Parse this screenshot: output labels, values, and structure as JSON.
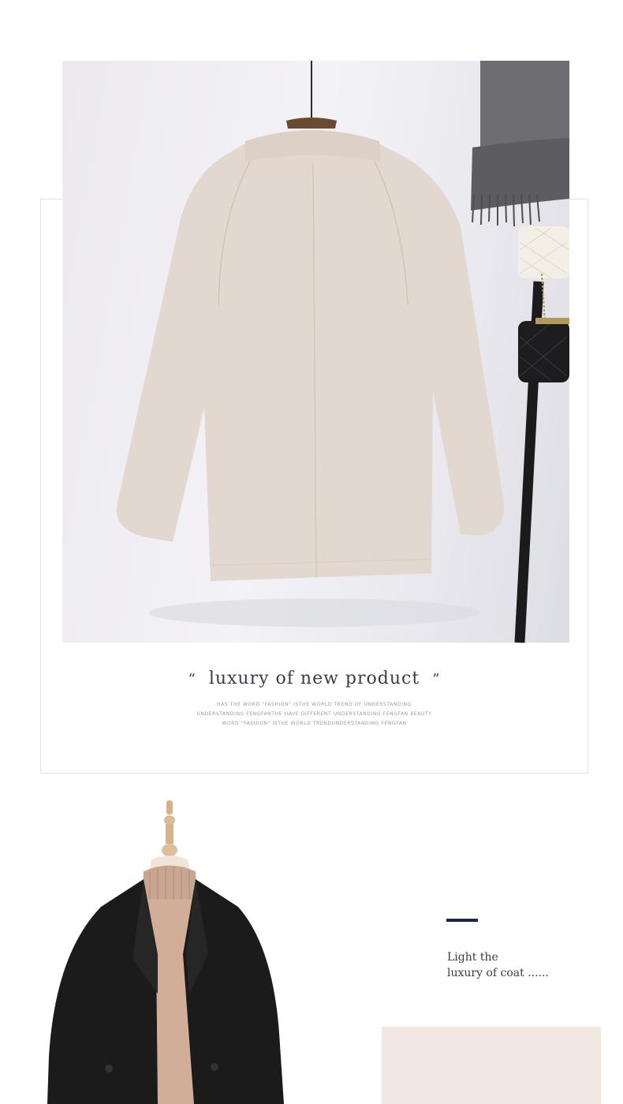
{
  "hero": {
    "quote_open": "“",
    "quote_title": "luxury of new product",
    "quote_close": "”",
    "sub_lines": [
      "HAS THE WORD \"FASHION\" ISTHE WORLD TREND OF UNDERSTANDING",
      "UNDERSTANDING FENGFANTHE  HAVE DIFFERENT UNDERSTANDING FENGFAN BEAUTY",
      "WORD \"FASHION\" ISTHE WORLD TRENDUNDERSTANDING FENGFAN"
    ]
  },
  "feature": {
    "tagline_line1": "Light the",
    "tagline_line2": "luxury of coat  ......"
  },
  "colors": {
    "coat_beige": "#e3d8cf",
    "coat_black": "#1b1b1b",
    "accent": "#1e2450",
    "swatch": "#f2e7e1"
  }
}
